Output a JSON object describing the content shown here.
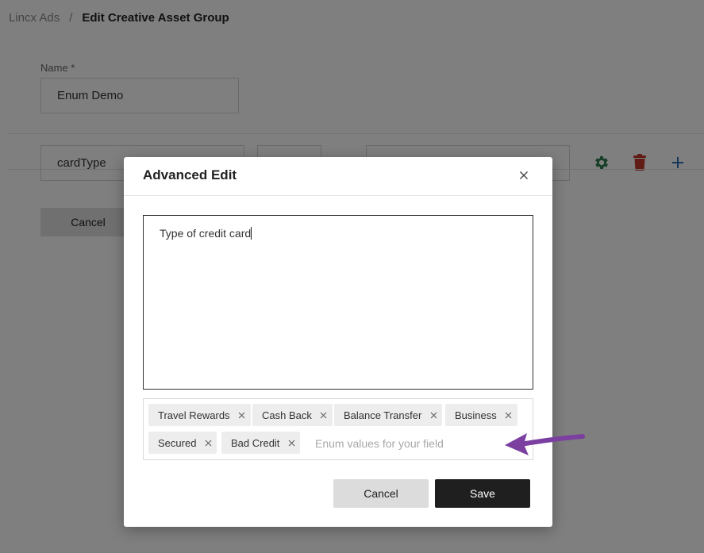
{
  "breadcrumb": {
    "root": "Lincx Ads",
    "separator": "/",
    "current": "Edit Creative Asset Group"
  },
  "form": {
    "name_label": "Name *",
    "name_value": "Enum Demo",
    "field_name_value": "cardType",
    "field_type_value": "",
    "field_default_value": "",
    "cancel_label": "Cancel"
  },
  "field_actions": {
    "settings_icon": "gear-icon",
    "delete_icon": "trash-icon",
    "add_icon": "plus-icon"
  },
  "modal": {
    "title": "Advanced Edit",
    "close_symbol": "×",
    "description": "Type of credit card",
    "tags": [
      {
        "label": "Travel Rewards",
        "remove": "×"
      },
      {
        "label": "Cash Back",
        "remove": "×"
      },
      {
        "label": "Balance Transfer",
        "remove": "×"
      },
      {
        "label": "Business",
        "remove": "×"
      },
      {
        "label": "Secured",
        "remove": "×"
      },
      {
        "label": "Bad Credit",
        "remove": "×"
      }
    ],
    "enum_placeholder": "Enum values for your field",
    "cancel_label": "Cancel",
    "save_label": "Save"
  },
  "colors": {
    "gear": "#2e7d4f",
    "trash": "#c0392b",
    "plus": "#2f6fb0",
    "annotation_arrow": "#7b3fa0"
  }
}
